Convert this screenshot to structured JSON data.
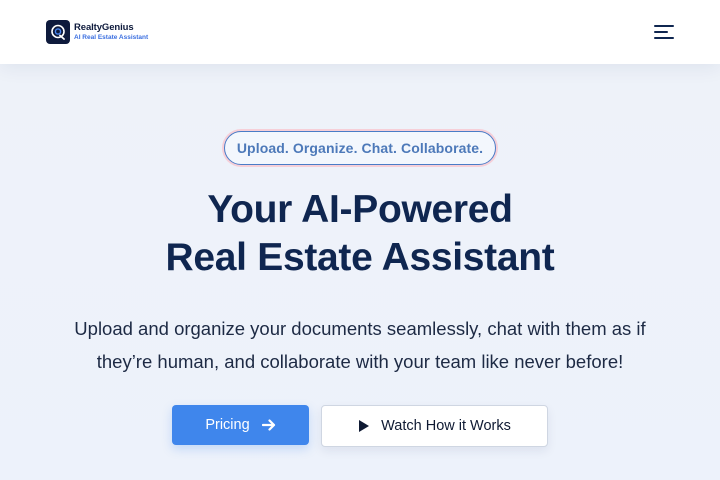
{
  "header": {
    "brand_name": "RealtyGenius",
    "brand_tagline": "AI Real Estate Assistant",
    "logo_icon": "chat-bubble-logo-icon",
    "menu_icon": "hamburger-menu-icon"
  },
  "hero": {
    "pill_text": "Upload. Organize. Chat. Collaborate.",
    "title_line1": "Your AI-Powered",
    "title_line2": "Real Estate Assistant",
    "subtitle_line1": "Upload and organize your documents seamlessly, chat with them as if",
    "subtitle_line2": "they’re human, and collaborate with your team like never before!",
    "primary_button": {
      "label": "Pricing",
      "icon": "arrow-right-icon"
    },
    "secondary_button": {
      "label": "Watch How it Works",
      "icon": "play-icon"
    }
  },
  "colors": {
    "brand_navy": "#0f2650",
    "accent_blue": "#3f86ec",
    "pill_border": "#4a7cc7",
    "pill_glow": "#f6cfd8",
    "background": "#edf2fa"
  }
}
